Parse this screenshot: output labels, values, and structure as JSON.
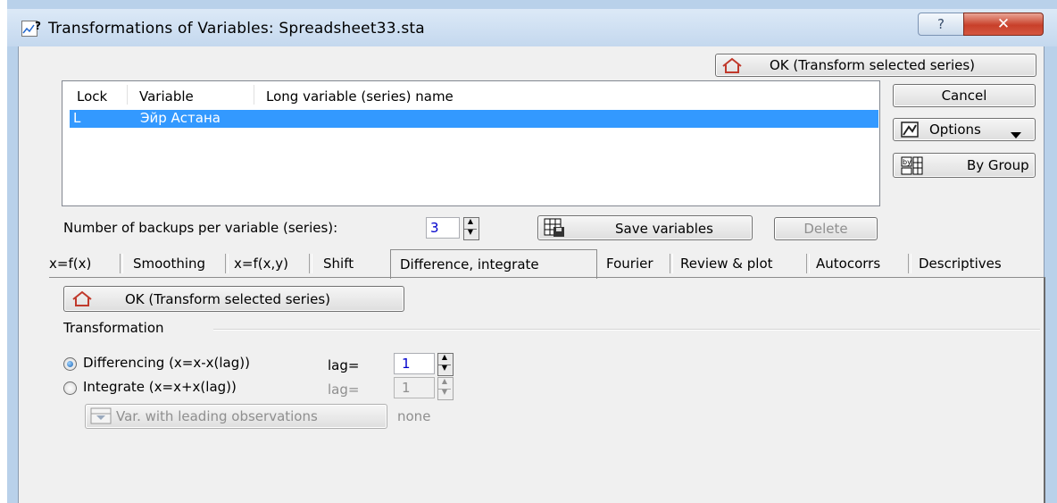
{
  "window": {
    "title": "Transformations of Variables: Spreadsheet33.sta",
    "help_glyph": "?",
    "close_glyph": "✕"
  },
  "side_buttons": {
    "ok_top": "OK (Transform selected series)",
    "cancel": "Cancel",
    "options": "Options",
    "by_group": "By Group"
  },
  "list": {
    "headers": {
      "lock": "Lock",
      "variable": "Variable",
      "long_name": "Long variable (series) name"
    },
    "rows": [
      {
        "lock": "L",
        "variable": "Эйр Астана",
        "long_name": ""
      }
    ]
  },
  "backups": {
    "label": "Number of backups per variable (series):",
    "value": "3",
    "save_button": "Save variables",
    "delete_button": "Delete"
  },
  "tabs": [
    {
      "label": "x=f(x)",
      "active": false
    },
    {
      "label": "Smoothing",
      "active": false
    },
    {
      "label": "x=f(x,y)",
      "active": false
    },
    {
      "label": "Shift",
      "active": false
    },
    {
      "label": "Difference, integrate",
      "active": true
    },
    {
      "label": "Fourier",
      "active": false
    },
    {
      "label": "Review & plot",
      "active": false
    },
    {
      "label": "Autocorrs",
      "active": false
    },
    {
      "label": "Descriptives",
      "active": false
    }
  ],
  "panel": {
    "ok_button": "OK (Transform selected series)",
    "group_label": "Transformation",
    "differencing": {
      "label": "Differencing (x=x-x(lag))",
      "checked": true,
      "lag_label": "lag=",
      "lag_value": "1"
    },
    "integrate": {
      "label": "Integrate (x=x+x(lag))",
      "checked": false,
      "lag_label": "lag=",
      "lag_value": "1"
    },
    "leading_button": "Var. with leading observations",
    "leading_value": "none"
  },
  "colors": {
    "selection": "#3399ff",
    "frame": "#b9d1ea",
    "close": "#c8402a",
    "ok_arrow": "#c0392b"
  }
}
